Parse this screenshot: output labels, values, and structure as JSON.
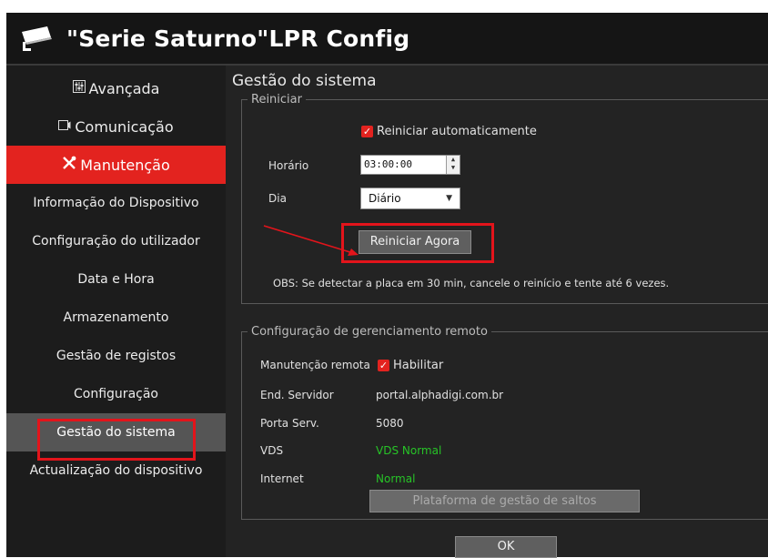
{
  "app": {
    "title": "\"Serie Saturno\"LPR Config"
  },
  "sidebar": {
    "items": [
      {
        "label": "Avançada",
        "icon": "sliders-icon"
      },
      {
        "label": "Comunicação",
        "icon": "monitor-icon"
      },
      {
        "label": "Manutenção",
        "icon": "tools-icon"
      },
      {
        "label": "Informação do Dispositivo"
      },
      {
        "label": "Configuração do utilizador"
      },
      {
        "label": "Data e Hora"
      },
      {
        "label": "Armazenamento"
      },
      {
        "label": "Gestão de registos"
      },
      {
        "label": "Configuração"
      },
      {
        "label": "Gestão do sistema"
      },
      {
        "label": "Actualização do dispositivo"
      }
    ]
  },
  "main": {
    "title": "Gestão do sistema",
    "restart": {
      "legend": "Reiniciar",
      "auto_label": "Reiniciar automaticamente",
      "auto_checked": true,
      "time_label": "Horário",
      "time_value": "03:00:00",
      "day_label": "Dia",
      "day_value": "Diário",
      "restart_now": "Reiniciar Agora",
      "note": "OBS: Se detectar a placa em 30 min, cancele o reinício e tente até 6 vezes."
    },
    "remote": {
      "legend": "Configuração de gerenciamento remoto",
      "maint_label": "Manutenção remota",
      "enable_label": "Habilitar",
      "enable_checked": true,
      "server_label": "End. Servidor",
      "server_value": "portal.alphadigi.com.br",
      "port_label": "Porta Serv.",
      "port_value": "5080",
      "vds_label": "VDS",
      "vds_value": "VDS Normal",
      "internet_label": "Internet",
      "internet_value": "Normal",
      "platform_button": "Plataforma de gestão de saltos"
    },
    "ok": "OK"
  },
  "colors": {
    "accent": "#e3231f",
    "highlight_box": "#e3141b",
    "status_ok": "#27c427"
  }
}
